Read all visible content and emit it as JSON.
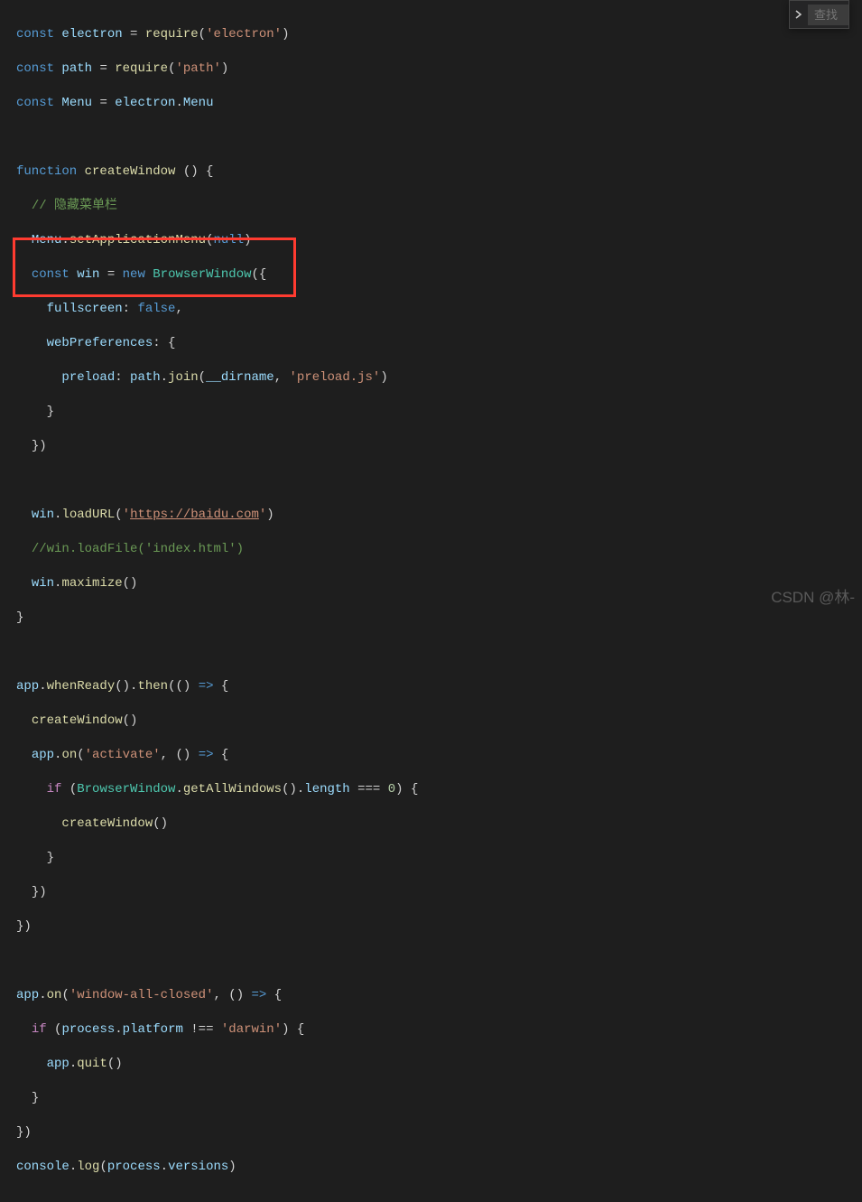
{
  "findWidget": {
    "placeholder": "查找"
  },
  "highlight": {
    "present": true
  },
  "watermark": "CSDN @林-",
  "code": {
    "l1": {
      "p1": "const",
      "p2": " electron ",
      "p3": "=",
      "p4": " ",
      "p5": "require",
      "p6": "(",
      "p7": "'electron'",
      "p8": ")"
    },
    "l2": {
      "p1": "const",
      "p2": " path ",
      "p3": "=",
      "p4": " ",
      "p5": "require",
      "p6": "(",
      "p7": "'path'",
      "p8": ")"
    },
    "l3": {
      "p1": "const",
      "p2": " Menu ",
      "p3": "=",
      "p4": " electron",
      "p5": ".",
      "p6": "Menu"
    },
    "l4": "",
    "l5": {
      "p1": "function",
      "p2": " ",
      "p3": "createWindow",
      "p4": " () {"
    },
    "l6": {
      "indent": "  ",
      "p1": "// 隐藏菜单栏"
    },
    "l7": {
      "indent": "  ",
      "p1": "Menu",
      "p2": ".",
      "p3": "setApplicationMenu",
      "p4": "(",
      "p5": "null",
      "p6": ")"
    },
    "l8": {
      "indent": "  ",
      "p1": "const",
      "p2": " win ",
      "p3": "=",
      "p4": " ",
      "p5": "new",
      "p6": " ",
      "p7": "BrowserWindow",
      "p8": "({"
    },
    "l9": {
      "indent": "    ",
      "p1": "fullscreen",
      "p2": ": ",
      "p3": "false",
      "p4": ","
    },
    "l10": {
      "indent": "    ",
      "p1": "webPreferences",
      "p2": ": {"
    },
    "l11": {
      "indent": "      ",
      "p1": "preload",
      "p2": ": ",
      "p3": "path",
      "p4": ".",
      "p5": "join",
      "p6": "(",
      "p7": "__dirname",
      "p8": ", ",
      "p9": "'preload.js'",
      "p10": ")"
    },
    "l12": {
      "indent": "    ",
      "p1": "}"
    },
    "l13": {
      "indent": "  ",
      "p1": "})"
    },
    "l14": "",
    "l15": {
      "indent": "  ",
      "p1": "win",
      "p2": ".",
      "p3": "loadURL",
      "p4": "(",
      "p5": "'",
      "p6": "https://baidu.com",
      "p7": "'",
      "p8": ")"
    },
    "l16": {
      "indent": "  ",
      "p1": "//win.loadFile('index.html')"
    },
    "l17": {
      "indent": "  ",
      "p1": "win",
      "p2": ".",
      "p3": "maximize",
      "p4": "()"
    },
    "l18": {
      "p1": "}"
    },
    "l19": "",
    "l20": {
      "p1": "app",
      "p2": ".",
      "p3": "whenReady",
      "p4": "().",
      "p5": "then",
      "p6": "(() ",
      "p7": "=>",
      "p8": " {"
    },
    "l21": {
      "indent": "  ",
      "p1": "createWindow",
      "p2": "()"
    },
    "l22": {
      "indent": "  ",
      "p1": "app",
      "p2": ".",
      "p3": "on",
      "p4": "(",
      "p5": "'activate'",
      "p6": ", () ",
      "p7": "=>",
      "p8": " {"
    },
    "l23": {
      "indent": "    ",
      "p1": "if",
      "p2": " (",
      "p3": "BrowserWindow",
      "p4": ".",
      "p5": "getAllWindows",
      "p6": "().",
      "p7": "length",
      "p8": " === ",
      "p9": "0",
      "p10": ") {"
    },
    "l24": {
      "indent": "      ",
      "p1": "createWindow",
      "p2": "()"
    },
    "l25": {
      "indent": "    ",
      "p1": "}"
    },
    "l26": {
      "indent": "  ",
      "p1": "})"
    },
    "l27": {
      "p1": "})"
    },
    "l28": "",
    "l29": {
      "p1": "app",
      "p2": ".",
      "p3": "on",
      "p4": "(",
      "p5": "'window-all-closed'",
      "p6": ", () ",
      "p7": "=>",
      "p8": " {"
    },
    "l30": {
      "indent": "  ",
      "p1": "if",
      "p2": " (",
      "p3": "process",
      "p4": ".",
      "p5": "platform",
      "p6": " !== ",
      "p7": "'darwin'",
      "p8": ") {"
    },
    "l31": {
      "indent": "    ",
      "p1": "app",
      "p2": ".",
      "p3": "quit",
      "p4": "()"
    },
    "l32": {
      "indent": "  ",
      "p1": "}"
    },
    "l33": {
      "p1": "})"
    },
    "l34": {
      "p1": "console",
      "p2": ".",
      "p3": "log",
      "p4": "(",
      "p5": "process",
      "p6": ".",
      "p7": "versions",
      "p8": ")"
    }
  }
}
